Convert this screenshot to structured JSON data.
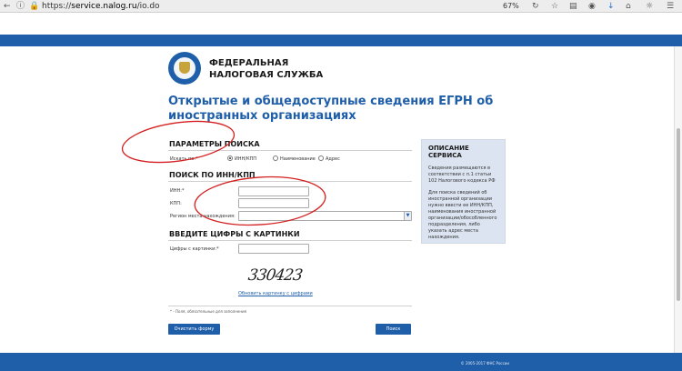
{
  "browser": {
    "url_scheme": "https://",
    "url_host": "service.nalog.ru",
    "url_path": "/io.do",
    "zoom": "67%",
    "icons": [
      "back-icon",
      "info-icon",
      "lock-icon",
      "reload-icon",
      "bookmark-icon",
      "menu-icon"
    ]
  },
  "header": {
    "org_line1": "ФЕДЕРАЛЬНАЯ",
    "org_line2": "НАЛОГОВАЯ СЛУЖБА"
  },
  "page": {
    "title": "Открытые и общедоступные сведения ЕГРН об иностранных организациях"
  },
  "search_params": {
    "title": "ПАРАМЕТРЫ ПОИСКА",
    "search_by_label": "Искать по:*",
    "options": [
      "ИНН/КПП",
      "Наименование",
      "Адрес"
    ]
  },
  "search_inn": {
    "title": "ПОИСК ПО ИНН/КПП",
    "inn_label": "ИНН:*",
    "kpp_label": "КПП:",
    "region_label": "Регион места нахождения:"
  },
  "captcha": {
    "title": "ВВЕДИТЕ ЦИФРЫ С КАРТИНКИ",
    "input_label": "Цифры с картинки:*",
    "image_text": "330423",
    "refresh_link": "Обновить картинку с цифрами"
  },
  "form": {
    "note": "* - Поля, обязательные для заполнения",
    "clear_button": "Очистить форму",
    "search_button": "Поиск"
  },
  "sidebar": {
    "title": "ОПИСАНИЕ СЕРВИСА",
    "para1": "Сведения размещаются в соответствии с п.1 статьи 102 Налогового кодекса РФ",
    "para2": "Для поиска сведений об иностранной организации нужно ввести ее ИНН/КПП, наименования иностранной организации/обособленного подразделения, либо указать адрес места нахождения."
  },
  "footer": {
    "copyright": "© 2005-2017 ФНС России"
  },
  "colors": {
    "brand_blue": "#1f5ea8",
    "annotation_red": "#d42020",
    "sidebar_bg": "#dbe4f0"
  }
}
